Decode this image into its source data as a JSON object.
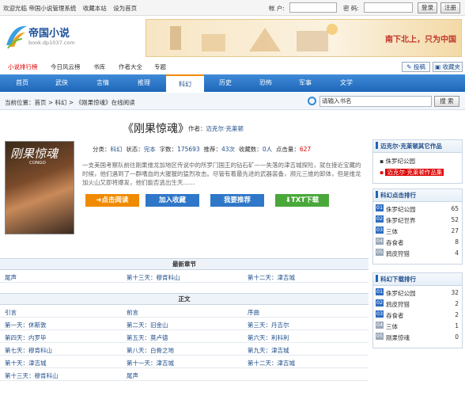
{
  "topbar": {
    "links": [
      "欢迎光临 帝国小说管理系统",
      "收藏本站",
      "设为首页"
    ],
    "account_label": "帐 户:",
    "password_label": "密 码:",
    "login_button": "登录",
    "register_button": "注册"
  },
  "logo": {
    "name": "帝国小说",
    "url": "book.dp1037.com"
  },
  "banner": {
    "text": "南下北上，只为中国"
  },
  "subnav": {
    "items": [
      "小说排行榜",
      "今日风云榜",
      "书库",
      "作者大全",
      "专题"
    ],
    "submit_button": "投稿",
    "collect_button": "收藏夹"
  },
  "mainnav": {
    "items": [
      "首页",
      "武侠",
      "言情",
      "推理",
      "科幻",
      "历史",
      "恐怖",
      "军事",
      "文学"
    ],
    "active": "科幻"
  },
  "breadcrumb": {
    "text": "当前位置：首页 > 科幻 > 《刚果惊魂》在线阅读",
    "search_placeholder": "请输入书名",
    "search_button": "搜 索"
  },
  "book": {
    "title": "《刚果惊魂》",
    "author_label": "作者：",
    "author": "迈克尔·克莱顿",
    "cover_title": "刚果惊魂",
    "cover_sub": "CONGO",
    "meta": {
      "category_label": "分类：",
      "category": "科幻",
      "status_label": "状态：",
      "status": "完本",
      "words_label": "字数：",
      "words": "175693",
      "recommend_label": "推荐：",
      "recommend": "43次",
      "collect_label": "收藏数：",
      "collect": "0人",
      "clicks_label": "点击量：",
      "clicks": "627"
    },
    "description": "一支美国考察队前往刚果维龙加地区传说中的所罗门国王的钻石矿——失落的津吉城探险，就在接近宝藏的时候，他们遇到了一群嗜血的大猩猩的猛烈攻击。尽管有着最先进的武器装备，濒元三维的卸体，但是维龙加火山又即将爆发，他们能否逃出生天……",
    "buttons": [
      "点击阅读",
      "加入收藏",
      "我要推荐",
      "TXT下载"
    ]
  },
  "latest": {
    "header": "最新章节",
    "items": [
      "尾声",
      "第十三天：穆肯科山",
      "第十二天：津吉城"
    ]
  },
  "contents": {
    "header": "正文",
    "items": [
      "引言",
      "前言",
      "序曲",
      "第一天：休斯敦",
      "第二天：旧金山",
      "第三天：丹吉尔",
      "第四天：内罗毕",
      "第五天：莫卢德",
      "第六天：利科利",
      "第七天：穆肯科山",
      "第八天：白骨之地",
      "第九天：津吉城",
      "第十天：津吉城",
      "第十一天：津吉城",
      "第十二天：津吉城",
      "第十三天：穆肯科山",
      "尾声"
    ]
  },
  "sidebar": {
    "author_box": {
      "title": "迈克尔·克莱顿其它作品",
      "items": [
        "侏罗纪公园",
        "迈克尔·克莱顿作品集"
      ]
    },
    "click_rank": {
      "title": "科幻点击排行",
      "items": [
        {
          "n": "01",
          "name": "侏罗纪公园",
          "count": "65"
        },
        {
          "n": "02",
          "name": "侏罗纪世界",
          "count": "52"
        },
        {
          "n": "03",
          "name": "三体",
          "count": "27"
        },
        {
          "n": "04",
          "name": "吞食者",
          "count": "8"
        },
        {
          "n": "05",
          "name": "鸦皮狩猎",
          "count": "4"
        }
      ]
    },
    "download_rank": {
      "title": "科幻下载排行",
      "items": [
        {
          "n": "01",
          "name": "侏罗纪公园",
          "count": "32"
        },
        {
          "n": "02",
          "name": "鸦皮狩猎",
          "count": "2"
        },
        {
          "n": "03",
          "name": "吞食者",
          "count": "2"
        },
        {
          "n": "04",
          "name": "三体",
          "count": "1"
        },
        {
          "n": "05",
          "name": "刚果惊魂",
          "count": "0"
        }
      ]
    }
  },
  "colors": {
    "accent": "#1f66b8",
    "rank_top": "#2d6cc0",
    "rank_other": "#9aa8b8",
    "btn_read": "#f08a00",
    "btn_collect": "#2f77c8",
    "btn_recommend": "#2f77c8",
    "btn_txt": "#4aa83a"
  }
}
